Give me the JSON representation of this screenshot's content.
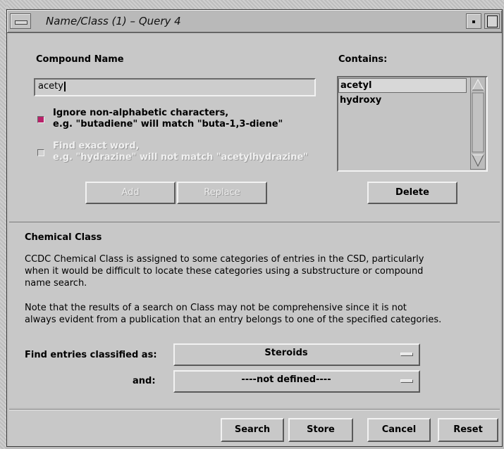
{
  "window": {
    "title": "Name/Class (1) – Query 4"
  },
  "compound": {
    "name_label": "Compound Name",
    "name_value": "acety",
    "contains_label": "Contains:",
    "contains_items": [
      "acetyl",
      "hydroxy"
    ],
    "selected_item": "acetyl",
    "ignore_non_alpha": {
      "checked": true,
      "line1": "Ignore non-alphabetic characters,",
      "line2": "e.g. \"butadiene\" will match \"buta-1,3-diene\""
    },
    "exact_word": {
      "checked": false,
      "enabled": false,
      "line1": "Find exact word,",
      "line2": "e.g. \"hydrazine\" will not match \"acetylhydrazine\""
    },
    "add_label": "Add",
    "replace_label": "Replace",
    "delete_label": "Delete"
  },
  "chemical_class": {
    "heading": "Chemical Class",
    "para1": [
      "CCDC Chemical Class is assigned to some categories of entries in the CSD, particularly",
      "when it would be difficult to locate these categories using a substructure or compound",
      "name search."
    ],
    "para2": [
      "Note that the results of a search on Class may not be comprehensive since it is not",
      "always evident from a publication that an entry belongs to one of the specified categories."
    ],
    "find_label": "Find entries classified as:",
    "find_value": "Steroids",
    "and_label": "and:",
    "and_value": "----not defined----"
  },
  "actions": {
    "search": "Search",
    "store": "Store",
    "cancel": "Cancel",
    "reset": "Reset"
  },
  "colors": {
    "checkbox_on": "#b8226a",
    "background": "#c8c8c8"
  }
}
